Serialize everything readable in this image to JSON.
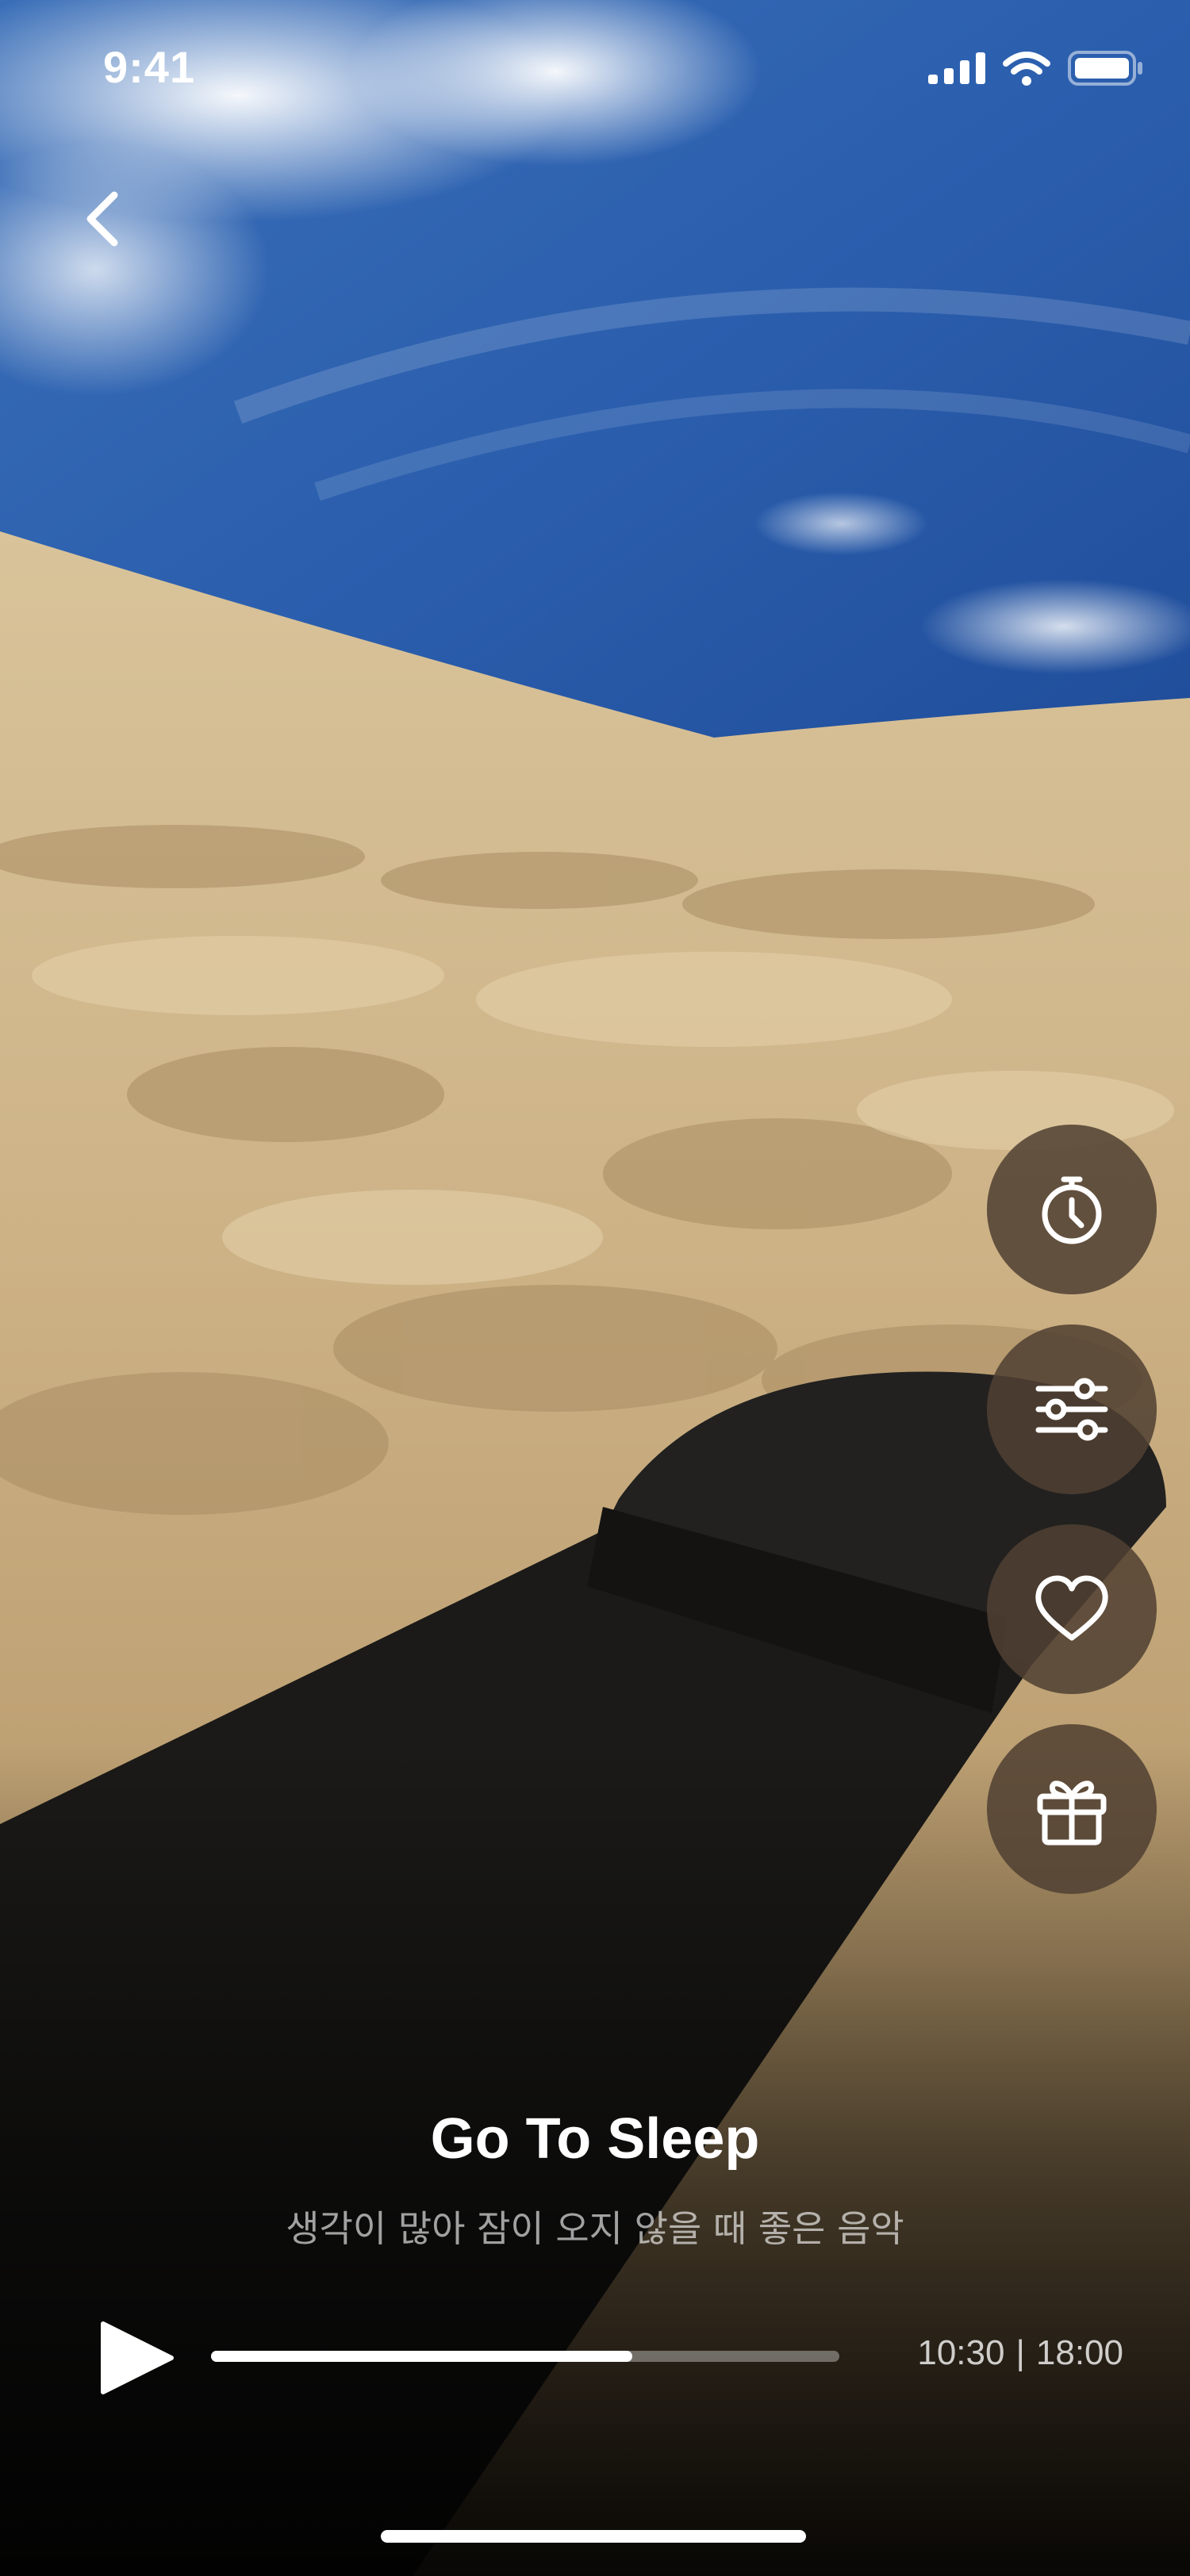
{
  "status_bar": {
    "time": "9:41",
    "signal_icon": "cellular-signal-icon",
    "wifi_icon": "wifi-icon",
    "battery_icon": "battery-icon"
  },
  "nav": {
    "back_icon": "chevron-left-icon"
  },
  "side_actions": [
    {
      "name": "timer",
      "icon": "stopwatch-icon"
    },
    {
      "name": "mixer",
      "icon": "sliders-icon"
    },
    {
      "name": "favorite",
      "icon": "heart-icon"
    },
    {
      "name": "gift",
      "icon": "gift-icon"
    }
  ],
  "player": {
    "title": "Go To Sleep",
    "subtitle": "생각이 많아 잠이 오지 않을 때 좋은 음악",
    "elapsed": "10:30",
    "separator": "|",
    "duration": "18:00",
    "progress": 0.67,
    "play_icon": "play-icon"
  },
  "colors": {
    "button_bg": "#504032",
    "sky": "#2f64b4",
    "sand": "#cdb488"
  }
}
